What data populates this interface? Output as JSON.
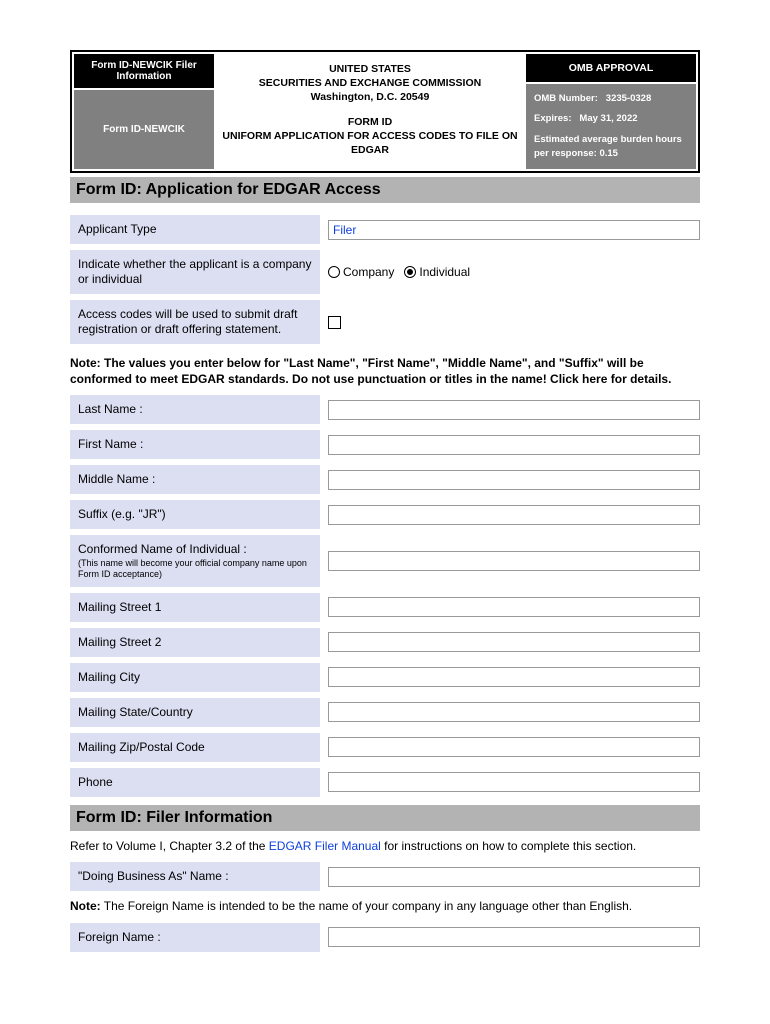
{
  "header": {
    "left_top": "Form ID-NEWCIK Filer Information",
    "left_bot": "Form ID-NEWCIK",
    "mid_line1": "UNITED STATES",
    "mid_line2": "SECURITIES AND EXCHANGE COMMISSION",
    "mid_line3": "Washington, D.C. 20549",
    "mid_line4": "FORM ID",
    "mid_line5": "UNIFORM APPLICATION FOR ACCESS CODES TO FILE ON EDGAR",
    "right_top": "OMB APPROVAL",
    "omb_number_label": "OMB Number:",
    "omb_number": "3235-0328",
    "expires_label": "Expires:",
    "expires": "May 31, 2022",
    "burden": "Estimated average burden hours per response: 0.15"
  },
  "section1": {
    "title": "Form ID: Application for EDGAR Access",
    "applicant_type_label": "Applicant Type",
    "applicant_type_value": "Filer",
    "indicate_label": "Indicate whether the applicant is a company or individual",
    "opt_company": "Company",
    "opt_individual": "Individual",
    "draft_label": "Access codes will be used to submit draft registration or draft offering statement.",
    "note": "Note: The values you enter below for \"Last Name\", \"First Name\", \"Middle Name\", and \"Suffix\" will be conformed to meet EDGAR standards. Do not use punctuation or titles in the name! Click here for details.",
    "fields": {
      "last_name": "Last Name :",
      "first_name": "First Name :",
      "middle_name": "Middle Name :",
      "suffix": "Suffix (e.g. \"JR\")",
      "conformed": "Conformed Name of Individual :",
      "conformed_sub": "(This name will become your official company name upon Form ID acceptance)",
      "street1": "Mailing Street 1",
      "street2": "Mailing Street 2",
      "city": "Mailing City",
      "state": "Mailing State/Country",
      "zip": "Mailing Zip/Postal Code",
      "phone": "Phone"
    }
  },
  "section2": {
    "title": "Form ID: Filer Information",
    "refer_pre": "Refer to Volume I, Chapter 3.2 of the ",
    "refer_link": "EDGAR Filer Manual",
    "refer_post": " for instructions on how to complete this section.",
    "dba_label": "\"Doing Business As\" Name :",
    "note_label": "Note:",
    "note_text": " The Foreign Name is intended to be the name of your company in any language other than English.",
    "foreign_label": "Foreign Name :"
  }
}
